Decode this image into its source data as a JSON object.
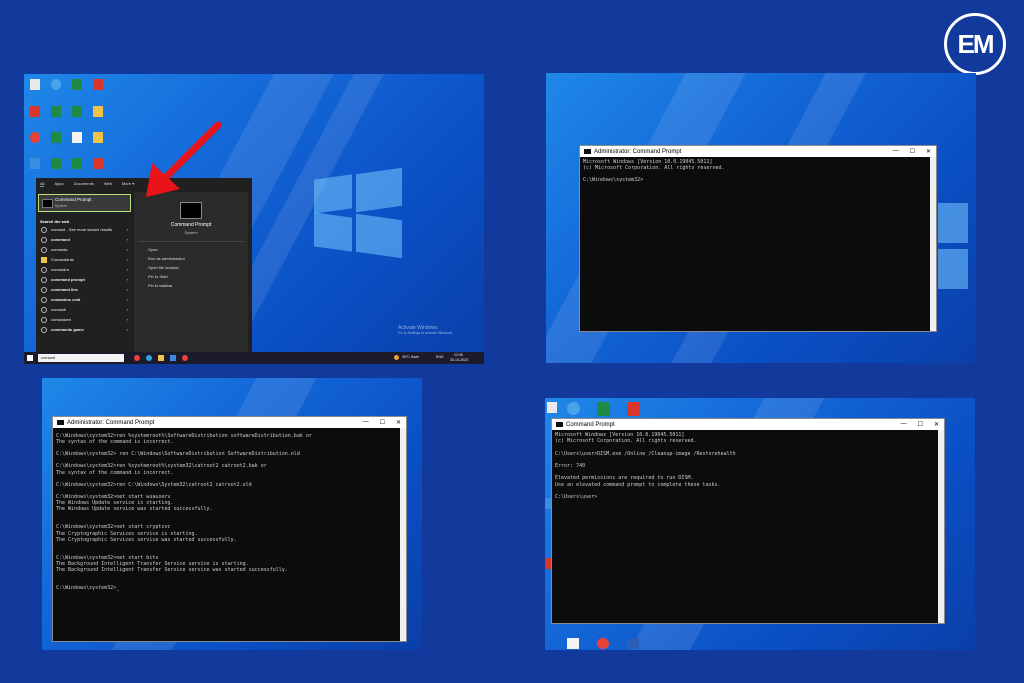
{
  "logo": {
    "text": "EM"
  },
  "panel1": {
    "start_menu": {
      "tabs": [
        "All",
        "Apps",
        "Documents",
        "Web",
        "More ▾"
      ],
      "best_match": "Command Prompt",
      "best_match_sub": "System",
      "search_web_label": "Search the web",
      "web_items": [
        "comand - See more search results",
        "command",
        "comanda",
        "Comandante",
        "comandra",
        "command prompt",
        "command line",
        "comandos cmd",
        "comandi",
        "comandant",
        "commands game"
      ],
      "preview_title": "Command Prompt",
      "preview_sub": "System",
      "actions": [
        "Open",
        "Run as administrator",
        "Open file location",
        "Pin to Start",
        "Pin to taskbar"
      ]
    },
    "search_text": "comand",
    "activate_line1": "Activate Windows",
    "activate_line2": "Go to Settings to activate Windows.",
    "tray_weather": "30°C Haze",
    "tray_lang": "ENG",
    "tray_time": "12:45",
    "tray_date": "30-10-2023"
  },
  "panel2": {
    "title": "Administrator: Command Prompt",
    "lines": "Microsoft Windows [Version 10.0.19045.5011]\n(c) Microsoft Corporation. All rights reserved.\n\nC:\\Windows\\system32>"
  },
  "panel3": {
    "title": "Administrator: Command Prompt",
    "lines": "C:\\Windows\\system32>ren %systemroot%\\SoftwareDistribution softwareDistribution.bak or\nThe syntax of the command is incorrect.\n\nC:\\Windows\\system32> ren C:\\Windows\\SoftwareDistribution SoftwareDistribution.old\n\nC:\\Windows\\system32>ren %systemroot%\\system32\\catroot2 catroot2.bak or\nThe syntax of the command is incorrect.\n\nC:\\Windows\\system32>ren C:\\Windows\\System32\\catroot2 catroot2.old\n\nC:\\Windows\\system32>net start wuauserv\nThe Windows Update service is starting.\nThe Windows Update service was started successfully.\n\n\nC:\\Windows\\system32>net start cryptsvc\nThe Cryptographic Services service is starting.\nThe Cryptographic Services service was started successfully.\n\n\nC:\\Windows\\system32>net start bits\nThe Background Intelligent Transfer Service service is starting.\nThe Background Intelligent Transfer Service service was started successfully.\n\n\nC:\\Windows\\system32>_"
  },
  "panel4": {
    "title": "Command Prompt",
    "lines": "Microsoft Windows [Version 10.0.19045.5011]\n(c) Microsoft Corporation. All rights reserved.\n\nC:\\Users\\user>DISM.exe /Online /Cleanup-image /Restorehealth\n\nError: 740\n\nElevated permissions are required to run DISM.\nUse an elevated command prompt to complete these tasks.\n\nC:\\Users\\user>"
  },
  "colors": {
    "background": "#123a9c",
    "cmd_bg": "#0c0c0c",
    "arrow": "#e8141a",
    "highlight": "#b9e07a"
  }
}
